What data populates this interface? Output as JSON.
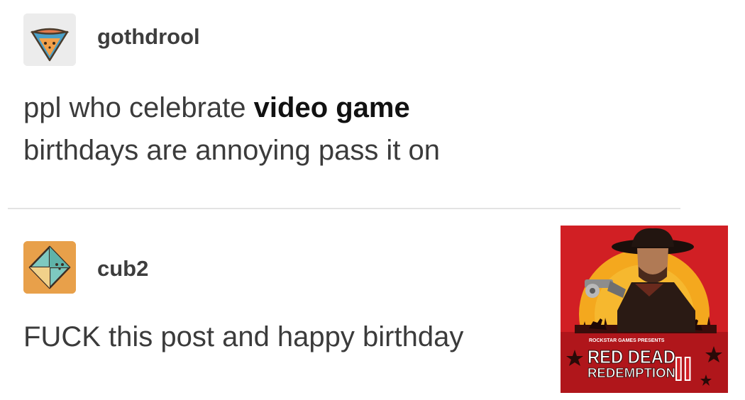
{
  "posts": [
    {
      "username": "gothdrool",
      "avatar_icon": "pizza-slice-icon",
      "text_before": "ppl who celebrate ",
      "text_bold": "video game",
      "text_after": "birthdays are annoying pass it on"
    },
    {
      "username": "cub2",
      "avatar_icon": "octahedron-icon",
      "text": "FUCK this post and happy birthday",
      "image": {
        "presents_line": "ROCKSTAR GAMES PRESENTS",
        "title_line1": "RED DEAD",
        "title_line2": "REDEMPTION",
        "numeral": "II"
      }
    }
  ],
  "colors": {
    "avatar1_bg": "#ececec",
    "avatar2_bg": "#e8a04a",
    "cover_red": "#d11f24",
    "cover_sun": "#f4a81e"
  }
}
